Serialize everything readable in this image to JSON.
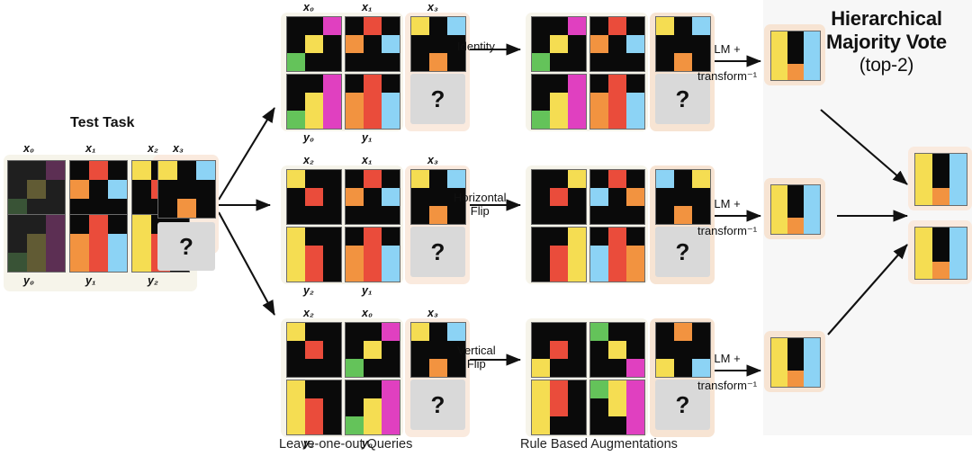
{
  "palette": {
    "black": "#0a0a0a",
    "magenta": "#e040c0",
    "yellow": "#f5dd52",
    "green": "#64c35a",
    "red": "#ea4c3b",
    "orange": "#f29340",
    "skyblue": "#8cd3f5",
    "panel_bg": "#f7f7f7",
    "card_cream": "#f6f4ea",
    "card_peach": "#faeade",
    "question_bg": "#d9d9d9"
  },
  "header": {
    "title_line1": "Hierarchical",
    "title_line2": "Majority Vote",
    "title_sub": "(top-2)"
  },
  "test_task": {
    "title": "Test Task",
    "top_labels": [
      "x₀",
      "x₁",
      "x₂"
    ],
    "bottom_labels": [
      "y₀",
      "y₁",
      "y₂"
    ],
    "query_label": "x₃",
    "question_mark": "?",
    "pairs": [
      {
        "name": "pair-x0-y0",
        "dimmed": true,
        "input": [
          [
            "black",
            "black",
            "magenta"
          ],
          [
            "black",
            "yellow",
            "black"
          ],
          [
            "green",
            "black",
            "black"
          ]
        ],
        "output": [
          [
            "black",
            "black",
            "magenta"
          ],
          [
            "black",
            "yellow",
            "magenta"
          ],
          [
            "green",
            "yellow",
            "magenta"
          ]
        ]
      },
      {
        "name": "pair-x1-y1",
        "dimmed": false,
        "input": [
          [
            "black",
            "red",
            "black"
          ],
          [
            "orange",
            "black",
            "skyblue"
          ],
          [
            "black",
            "black",
            "black"
          ]
        ],
        "output": [
          [
            "black",
            "red",
            "black"
          ],
          [
            "orange",
            "red",
            "skyblue"
          ],
          [
            "orange",
            "red",
            "skyblue"
          ]
        ]
      },
      {
        "name": "pair-x2-y2",
        "dimmed": false,
        "input": [
          [
            "yellow",
            "black",
            "black"
          ],
          [
            "black",
            "red",
            "black"
          ],
          [
            "black",
            "black",
            "black"
          ]
        ],
        "output": [
          [
            "yellow",
            "black",
            "black"
          ],
          [
            "yellow",
            "red",
            "black"
          ],
          [
            "yellow",
            "red",
            "black"
          ]
        ]
      }
    ],
    "query_grid": [
      [
        "yellow",
        "black",
        "skyblue"
      ],
      [
        "black",
        "black",
        "black"
      ],
      [
        "black",
        "orange",
        "black"
      ]
    ]
  },
  "captions": {
    "queries": "Leave-one-out Queries",
    "augmentations": "Rule Based Augmentations"
  },
  "branches": [
    {
      "name": "branch-identity",
      "transform_label": "Identity",
      "lm_label_top": "LM +",
      "lm_label_bottom": "transform⁻¹",
      "query": {
        "top_labels": [
          "x₀",
          "x₁"
        ],
        "bottom_labels": [
          "y₀",
          "y₁"
        ],
        "query_label": "x₃",
        "question_mark": "?",
        "pairs": [
          {
            "input": [
              [
                "black",
                "black",
                "magenta"
              ],
              [
                "black",
                "yellow",
                "black"
              ],
              [
                "green",
                "black",
                "black"
              ]
            ],
            "output": [
              [
                "black",
                "black",
                "magenta"
              ],
              [
                "black",
                "yellow",
                "magenta"
              ],
              [
                "green",
                "yellow",
                "magenta"
              ]
            ]
          },
          {
            "input": [
              [
                "black",
                "red",
                "black"
              ],
              [
                "orange",
                "black",
                "skyblue"
              ],
              [
                "black",
                "black",
                "black"
              ]
            ],
            "output": [
              [
                "black",
                "red",
                "black"
              ],
              [
                "orange",
                "red",
                "skyblue"
              ],
              [
                "orange",
                "red",
                "skyblue"
              ]
            ]
          }
        ],
        "query_grid": [
          [
            "yellow",
            "black",
            "skyblue"
          ],
          [
            "black",
            "black",
            "black"
          ],
          [
            "black",
            "orange",
            "black"
          ]
        ]
      },
      "augmented": {
        "question_mark": "?",
        "pairs": [
          {
            "input": [
              [
                "black",
                "black",
                "magenta"
              ],
              [
                "black",
                "yellow",
                "black"
              ],
              [
                "green",
                "black",
                "black"
              ]
            ],
            "output": [
              [
                "black",
                "black",
                "magenta"
              ],
              [
                "black",
                "yellow",
                "magenta"
              ],
              [
                "green",
                "yellow",
                "magenta"
              ]
            ]
          },
          {
            "input": [
              [
                "black",
                "red",
                "black"
              ],
              [
                "orange",
                "black",
                "skyblue"
              ],
              [
                "black",
                "black",
                "black"
              ]
            ],
            "output": [
              [
                "black",
                "red",
                "black"
              ],
              [
                "orange",
                "red",
                "skyblue"
              ],
              [
                "orange",
                "red",
                "skyblue"
              ]
            ]
          }
        ],
        "query_grid": [
          [
            "yellow",
            "black",
            "skyblue"
          ],
          [
            "black",
            "black",
            "black"
          ],
          [
            "black",
            "orange",
            "black"
          ]
        ]
      },
      "prediction": [
        [
          "yellow",
          "black",
          "skyblue"
        ],
        [
          "yellow",
          "black",
          "skyblue"
        ],
        [
          "yellow",
          "orange",
          "skyblue"
        ]
      ]
    },
    {
      "name": "branch-horizontal-flip",
      "transform_label": "Horizontal\nFlip",
      "transform_label_line1": "Horizontal",
      "transform_label_line2": "Flip",
      "lm_label_top": "LM +",
      "lm_label_bottom": "transform⁻¹",
      "query": {
        "top_labels": [
          "x₂",
          "x₁"
        ],
        "bottom_labels": [
          "y₂",
          "y₁"
        ],
        "query_label": "x₃",
        "question_mark": "?",
        "pairs": [
          {
            "input": [
              [
                "yellow",
                "black",
                "black"
              ],
              [
                "black",
                "red",
                "black"
              ],
              [
                "black",
                "black",
                "black"
              ]
            ],
            "output": [
              [
                "yellow",
                "black",
                "black"
              ],
              [
                "yellow",
                "red",
                "black"
              ],
              [
                "yellow",
                "red",
                "black"
              ]
            ]
          },
          {
            "input": [
              [
                "black",
                "red",
                "black"
              ],
              [
                "orange",
                "black",
                "skyblue"
              ],
              [
                "black",
                "black",
                "black"
              ]
            ],
            "output": [
              [
                "black",
                "red",
                "black"
              ],
              [
                "orange",
                "red",
                "skyblue"
              ],
              [
                "orange",
                "red",
                "skyblue"
              ]
            ]
          }
        ],
        "query_grid": [
          [
            "yellow",
            "black",
            "skyblue"
          ],
          [
            "black",
            "black",
            "black"
          ],
          [
            "black",
            "orange",
            "black"
          ]
        ]
      },
      "augmented": {
        "question_mark": "?",
        "pairs": [
          {
            "input": [
              [
                "black",
                "black",
                "yellow"
              ],
              [
                "black",
                "red",
                "black"
              ],
              [
                "black",
                "black",
                "black"
              ]
            ],
            "output": [
              [
                "black",
                "black",
                "yellow"
              ],
              [
                "black",
                "red",
                "yellow"
              ],
              [
                "black",
                "red",
                "yellow"
              ]
            ]
          },
          {
            "input": [
              [
                "black",
                "red",
                "black"
              ],
              [
                "skyblue",
                "black",
                "orange"
              ],
              [
                "black",
                "black",
                "black"
              ]
            ],
            "output": [
              [
                "black",
                "red",
                "black"
              ],
              [
                "skyblue",
                "red",
                "orange"
              ],
              [
                "skyblue",
                "red",
                "orange"
              ]
            ]
          }
        ],
        "query_grid": [
          [
            "skyblue",
            "black",
            "yellow"
          ],
          [
            "black",
            "black",
            "black"
          ],
          [
            "black",
            "orange",
            "black"
          ]
        ]
      },
      "prediction": [
        [
          "yellow",
          "black",
          "skyblue"
        ],
        [
          "yellow",
          "black",
          "skyblue"
        ],
        [
          "yellow",
          "orange",
          "skyblue"
        ]
      ]
    },
    {
      "name": "branch-vertical-flip",
      "transform_label_line1": "Vertical",
      "transform_label_line2": "Flip",
      "lm_label_top": "LM +",
      "lm_label_bottom": "transform⁻¹",
      "query": {
        "top_labels": [
          "x₂",
          "x₀"
        ],
        "bottom_labels": [
          "y₂",
          "y₀"
        ],
        "query_label": "x₃",
        "question_mark": "?",
        "pairs": [
          {
            "input": [
              [
                "yellow",
                "black",
                "black"
              ],
              [
                "black",
                "red",
                "black"
              ],
              [
                "black",
                "black",
                "black"
              ]
            ],
            "output": [
              [
                "yellow",
                "black",
                "black"
              ],
              [
                "yellow",
                "red",
                "black"
              ],
              [
                "yellow",
                "red",
                "black"
              ]
            ]
          },
          {
            "input": [
              [
                "black",
                "black",
                "magenta"
              ],
              [
                "black",
                "yellow",
                "black"
              ],
              [
                "green",
                "black",
                "black"
              ]
            ],
            "output": [
              [
                "black",
                "black",
                "magenta"
              ],
              [
                "black",
                "yellow",
                "magenta"
              ],
              [
                "green",
                "yellow",
                "magenta"
              ]
            ]
          }
        ],
        "query_grid": [
          [
            "yellow",
            "black",
            "skyblue"
          ],
          [
            "black",
            "black",
            "black"
          ],
          [
            "black",
            "orange",
            "black"
          ]
        ]
      },
      "augmented": {
        "question_mark": "?",
        "pairs": [
          {
            "input": [
              [
                "black",
                "black",
                "black"
              ],
              [
                "black",
                "red",
                "black"
              ],
              [
                "yellow",
                "black",
                "black"
              ]
            ],
            "output": [
              [
                "yellow",
                "red",
                "black"
              ],
              [
                "yellow",
                "red",
                "black"
              ],
              [
                "yellow",
                "black",
                "black"
              ]
            ]
          },
          {
            "input": [
              [
                "green",
                "black",
                "black"
              ],
              [
                "black",
                "yellow",
                "black"
              ],
              [
                "black",
                "black",
                "magenta"
              ]
            ],
            "output": [
              [
                "green",
                "yellow",
                "magenta"
              ],
              [
                "black",
                "yellow",
                "magenta"
              ],
              [
                "black",
                "black",
                "magenta"
              ]
            ]
          }
        ],
        "query_grid": [
          [
            "black",
            "orange",
            "black"
          ],
          [
            "black",
            "black",
            "black"
          ],
          [
            "yellow",
            "black",
            "skyblue"
          ]
        ]
      },
      "prediction": [
        [
          "yellow",
          "black",
          "skyblue"
        ],
        [
          "yellow",
          "black",
          "skyblue"
        ],
        [
          "yellow",
          "orange",
          "skyblue"
        ]
      ]
    }
  ],
  "final_votes": [
    {
      "name": "vote-1",
      "grid": [
        [
          "yellow",
          "black",
          "skyblue"
        ],
        [
          "yellow",
          "black",
          "skyblue"
        ],
        [
          "yellow",
          "orange",
          "skyblue"
        ]
      ]
    },
    {
      "name": "vote-2",
      "grid": [
        [
          "yellow",
          "black",
          "skyblue"
        ],
        [
          "yellow",
          "black",
          "skyblue"
        ],
        [
          "yellow",
          "orange",
          "skyblue"
        ]
      ]
    }
  ]
}
